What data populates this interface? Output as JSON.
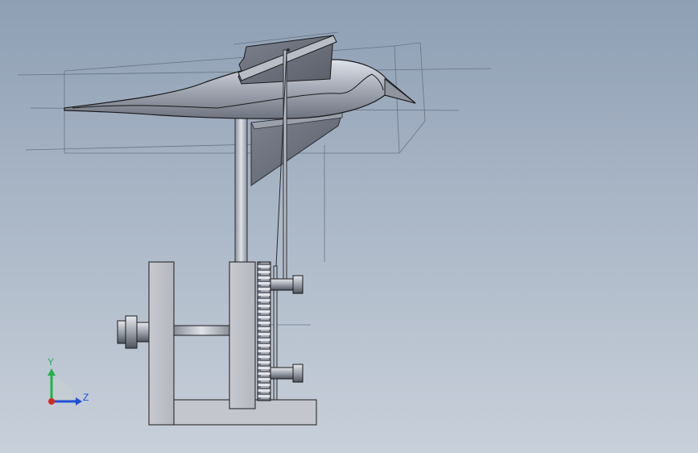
{
  "viewport": {
    "background_top": "#8e9fb4",
    "background_bottom": "#c8d0da"
  },
  "model": {
    "parts": [
      "bird-body",
      "bird-wing-upper",
      "bird-wing-lower",
      "support-post",
      "drive-rod",
      "gear-stack",
      "frame-plate-left",
      "frame-plate-right",
      "base-plate",
      "crank-shaft",
      "shaft-collar"
    ],
    "body_color": "#b9bec8",
    "edge_color": "#1a1a1a"
  },
  "triad": {
    "y_label": "Y",
    "z_label": "Z",
    "y_color": "#22b14c",
    "z_color": "#1f4fd6",
    "origin_color": "#d6281f"
  }
}
